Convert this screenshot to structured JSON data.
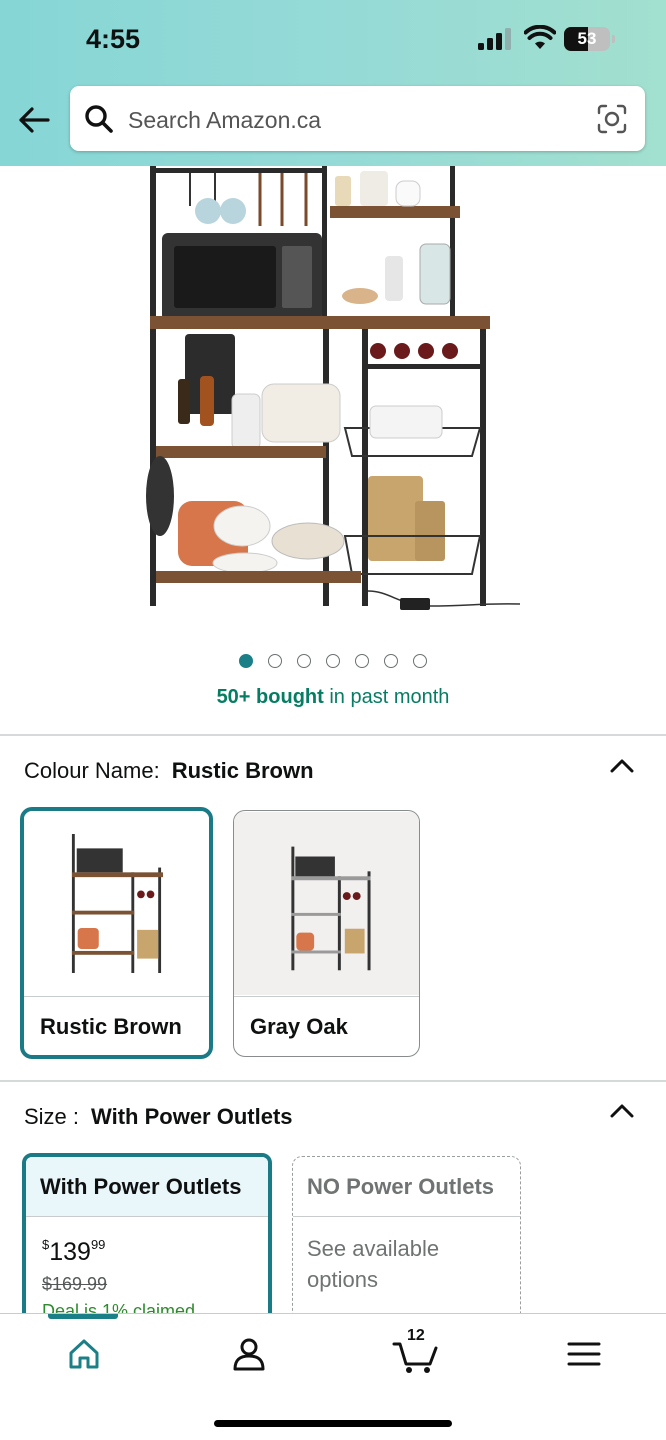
{
  "status_bar": {
    "time": "4:55",
    "battery_percent": "53",
    "battery_level": 0.53
  },
  "search": {
    "placeholder": "Search Amazon.ca"
  },
  "gallery": {
    "image_count": 7,
    "active_index": 0
  },
  "social_proof": {
    "bold": "50+ bought",
    "rest": " in past month"
  },
  "colour": {
    "label": "Colour Name:",
    "selected": "Rustic Brown",
    "options": [
      {
        "label": "Rustic Brown"
      },
      {
        "label": "Gray Oak"
      }
    ]
  },
  "size": {
    "label": "Size :",
    "selected": "With Power Outlets",
    "options": [
      {
        "label": "With Power Outlets",
        "currency": "$",
        "price_whole": "139",
        "price_fraction": "99",
        "list_price": "$169.99",
        "deal": "Deal is 1% claimed"
      },
      {
        "label": "NO Power Outlets",
        "note": "See available options"
      }
    ]
  },
  "bottom_nav": {
    "cart_count": "12",
    "items": [
      "home-icon",
      "account-icon",
      "cart-icon",
      "menu-icon"
    ]
  },
  "colors": {
    "accent": "#1b7f87",
    "header_gradient_start": "#86d6d6",
    "header_gradient_end": "#a2e0cf",
    "social_proof_green": "#067d62"
  }
}
